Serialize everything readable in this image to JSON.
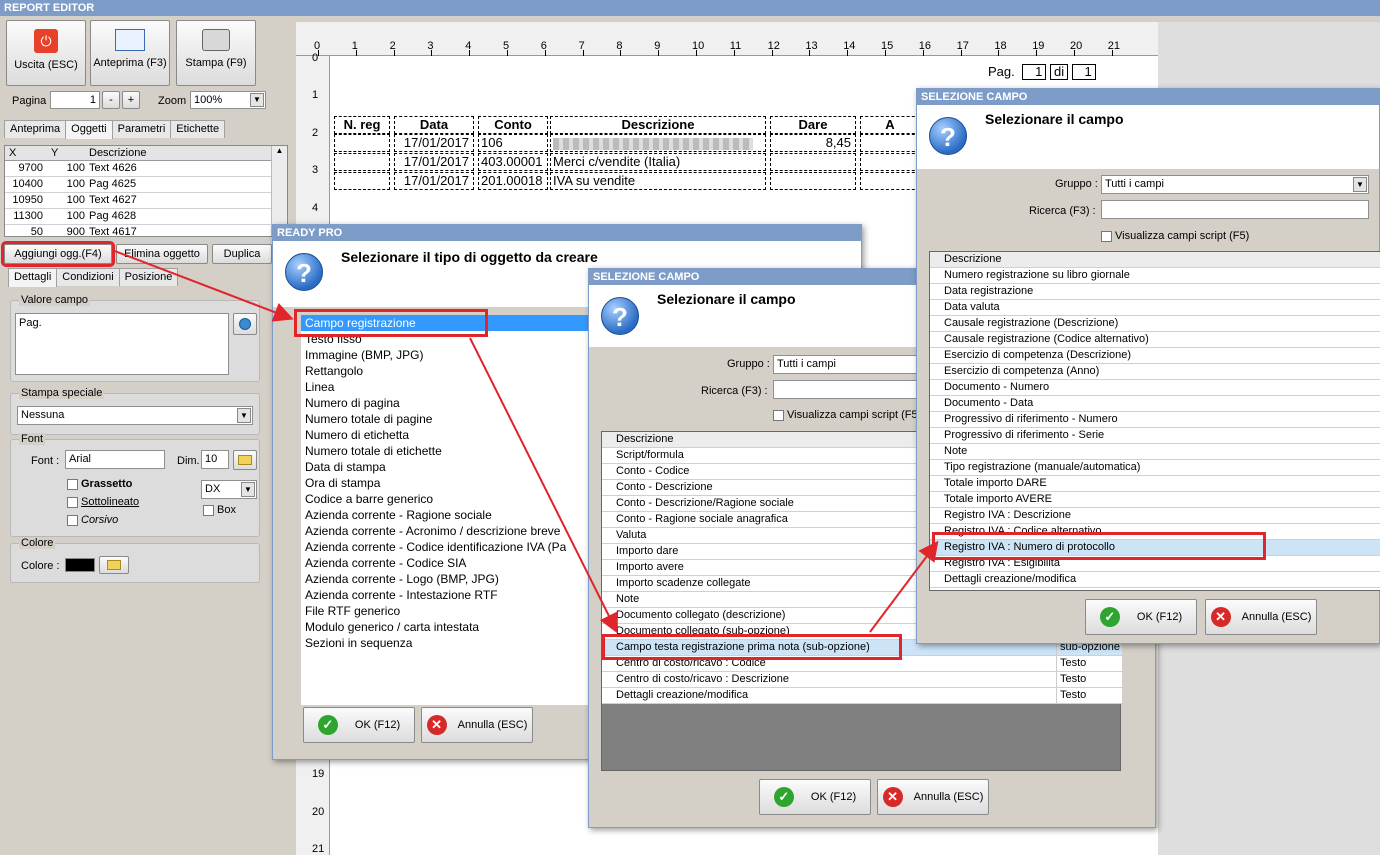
{
  "app": {
    "title": "REPORT EDITOR"
  },
  "toolbar": {
    "exit": "Uscita (ESC)",
    "preview": "Anteprima (F3)",
    "print": "Stampa (F9)",
    "page_label": "Pagina",
    "page_value": "1",
    "minus": "-",
    "plus": "+",
    "zoom_label": "Zoom",
    "zoom_value": "100%"
  },
  "tabs": [
    "Anteprima",
    "Oggetti",
    "Parametri",
    "Etichette"
  ],
  "objects": {
    "headers": [
      "X",
      "Y",
      "Descrizione"
    ],
    "rows": [
      [
        "9700",
        "100",
        "Text 4626"
      ],
      [
        "10400",
        "100",
        "Pag 4625"
      ],
      [
        "10950",
        "100",
        "Text 4627"
      ],
      [
        "11300",
        "100",
        "Pag 4628"
      ],
      [
        "50",
        "900",
        "Text 4617"
      ]
    ]
  },
  "actions": {
    "add": "Aggiungi ogg.(F4)",
    "delete": "Elimina oggetto",
    "duplicate": "Duplica"
  },
  "subtabs": [
    "Dettagli",
    "Condizioni",
    "Posizione"
  ],
  "props": {
    "field_value_label": "Valore campo",
    "field_value": "Pag.",
    "special_print_label": "Stampa speciale",
    "special_print_value": "Nessuna",
    "font_group": "Font",
    "font_label": "Font :",
    "font_value": "Arial",
    "dim_label": "Dim.",
    "dim_value": "10",
    "bold": "Grassetto",
    "underline": "Sottolineato",
    "italic": "Corsivo",
    "align_value": "DX",
    "box": "Box",
    "color_group": "Colore",
    "color_label": "Colore :"
  },
  "ruler_h": [
    "0",
    "1",
    "2",
    "3",
    "4",
    "5",
    "6",
    "7",
    "8",
    "9",
    "10",
    "11",
    "12",
    "13",
    "14",
    "15",
    "16",
    "17",
    "18",
    "19",
    "20",
    "21"
  ],
  "ruler_v": [
    "0",
    "1",
    "2",
    "3",
    "4",
    "19",
    "20",
    "21"
  ],
  "report": {
    "pag": "Pag.",
    "page_num": "1",
    "di": "di",
    "page_total": "1",
    "headers": [
      "N. reg",
      "Data",
      "Conto",
      "Descrizione",
      "Dare",
      "A"
    ],
    "rows": [
      [
        "17/01/2017",
        "106",
        "",
        "8,45"
      ],
      [
        "17/01/2017",
        "403.00001",
        "Merci c/vendite (Italia)",
        ""
      ],
      [
        "17/01/2017",
        "201.00018",
        "IVA su vendite",
        ""
      ]
    ]
  },
  "dlg1": {
    "title": "READY PRO",
    "heading": "Selezionare il tipo di oggetto da creare",
    "items": [
      "Campo registrazione",
      "Testo fisso",
      "Immagine (BMP, JPG)",
      "Rettangolo",
      "Linea",
      "Numero di pagina",
      "Numero totale di pagine",
      "Numero di etichetta",
      "Numero totale di etichette",
      "Data di stampa",
      "Ora di stampa",
      "Codice a barre generico",
      "Azienda corrente - Ragione sociale",
      "Azienda corrente - Acronimo / descrizione breve",
      "Azienda corrente - Codice identificazione IVA (Pa",
      "Azienda corrente - Codice SIA",
      "Azienda corrente - Logo (BMP, JPG)",
      "Azienda corrente - Intestazione RTF",
      "File RTF generico",
      "Modulo generico / carta intestata",
      "Sezioni in sequenza"
    ],
    "ok": "OK (F12)",
    "cancel": "Annulla (ESC)"
  },
  "dlg2": {
    "title": "SELEZIONE CAMPO",
    "heading": "Selezionare il campo",
    "group_label": "Gruppo :",
    "group_value": "Tutti i campi",
    "search_label": "Ricerca (F3) :",
    "script_label": "Visualizza campi script (F5",
    "col": "Descrizione",
    "items": [
      "Script/formula",
      "Conto - Codice",
      "Conto - Descrizione",
      "Conto - Descrizione/Ragione sociale",
      "Conto - Ragione sociale anagrafica",
      "Valuta",
      "Importo dare",
      "Importo avere",
      "Importo scadenze collegate",
      "Note",
      "Documento collegato (descrizione)",
      "Documento collegato (sub-opzione)",
      "Campo testa registrazione prima nota (sub-opzione)",
      "Centro di costo/ricavo : Codice",
      "Centro di costo/ricavo : Descrizione",
      "Dettagli creazione/modifica"
    ],
    "types": [
      "sub-opzione",
      "Testo",
      "Testo",
      "Testo"
    ],
    "ok": "OK (F12)",
    "cancel": "Annulla (ESC)"
  },
  "dlg3": {
    "title": "SELEZIONE CAMPO",
    "heading": "Selezionare il campo",
    "group_label": "Gruppo :",
    "group_value": "Tutti i campi",
    "search_label": "Ricerca (F3) :",
    "script_label": "Visualizza campi script (F5)",
    "col": "Descrizione",
    "items": [
      "Numero registrazione su libro giornale",
      "Data registrazione",
      "Data valuta",
      "Causale registrazione (Descrizione)",
      "Causale registrazione (Codice alternativo)",
      "Esercizio di competenza (Descrizione)",
      "Esercizio di competenza (Anno)",
      "Documento - Numero",
      "Documento - Data",
      "Progressivo di riferimento - Numero",
      "Progressivo di riferimento - Serie",
      "Note",
      "Tipo registrazione (manuale/automatica)",
      "Totale importo DARE",
      "Totale importo AVERE",
      "Registro IVA : Descrizione",
      "Registro IVA : Codice alternativo",
      "Registro IVA : Numero di protocollo",
      "Registro IVA : Esigibilità",
      "Dettagli creazione/modifica"
    ],
    "ok": "OK (F12)",
    "cancel": "Annulla (ESC)"
  }
}
